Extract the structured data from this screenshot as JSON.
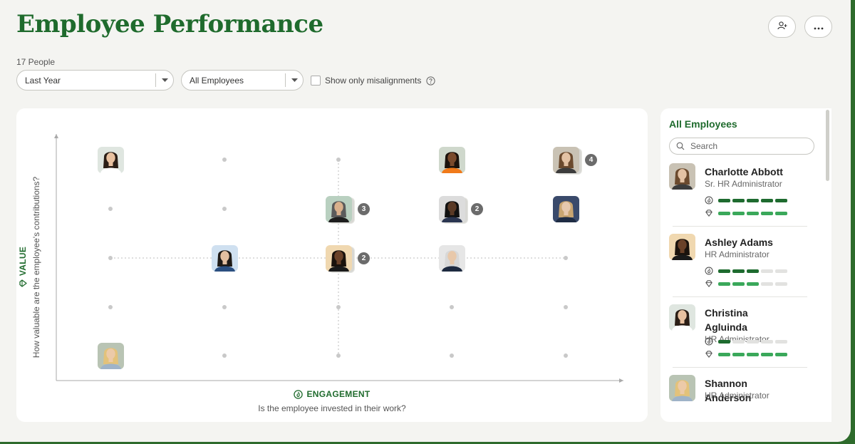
{
  "page": {
    "title": "Employee Performance",
    "people_count": "17 People"
  },
  "header_actions": {
    "add_person_icon": "add-person-icon",
    "more_icon": "more-icon"
  },
  "filters": {
    "period": "Last Year",
    "group": "All Employees",
    "misalignments_label": "Show only misalignments",
    "misalignments_checked": false
  },
  "chart": {
    "x_label": "ENGAGEMENT",
    "x_question": "Is the employee invested in their work?",
    "y_label": "VALUE",
    "y_question": "How valuable are the employee's contributions?",
    "grid_columns": 5,
    "grid_rows": 5,
    "cells": [
      {
        "col": 1,
        "row": 5,
        "count": 1,
        "skin": "#e8c1a0",
        "hair": "#2b1e16",
        "shirt": "#ffffff",
        "bg": "#dfe6e0"
      },
      {
        "col": 4,
        "row": 5,
        "count": 1,
        "skin": "#7a4a2c",
        "hair": "#1b120c",
        "shirt": "#f07a1a",
        "bg": "#cfd8cc"
      },
      {
        "col": 5,
        "row": 5,
        "count": 4,
        "skin": "#e3c2a4",
        "hair": "#6b4a2e",
        "shirt": "#3c3c3c",
        "bg": "#c9c2b4"
      },
      {
        "col": 3,
        "row": 4,
        "count": 3,
        "skin": "#d9b08c",
        "hair": "#5b5b5b",
        "shirt": "#1e1e1e",
        "bg": "#b9d0c0"
      },
      {
        "col": 4,
        "row": 4,
        "count": 2,
        "skin": "#5a3a26",
        "hair": "#111111",
        "shirt": "#2a3550",
        "bg": "#dcdcdc"
      },
      {
        "col": 5,
        "row": 4,
        "count": 1,
        "skin": "#e6c8ae",
        "hair": "#c9a571",
        "shirt": "#1f2c44",
        "bg": "#3a4a6b"
      },
      {
        "col": 2,
        "row": 3,
        "count": 1,
        "skin": "#e3bfa0",
        "hair": "#1f1a16",
        "shirt": "#2b4f80",
        "bg": "#cfe0f0"
      },
      {
        "col": 3,
        "row": 3,
        "count": 2,
        "skin": "#6a4128",
        "hair": "#1a120c",
        "shirt": "#1a1a1a",
        "bg": "#f0d8b0"
      },
      {
        "col": 4,
        "row": 3,
        "count": 1,
        "skin": "#e8c8aa",
        "hair": "#d8d8d8",
        "shirt": "#1e2a40",
        "bg": "#e6e6e6"
      },
      {
        "col": 1,
        "row": 1,
        "count": 1,
        "skin": "#eccaa8",
        "hair": "#e3c27a",
        "shirt": "#9fb3c8",
        "bg": "#b9c4b4"
      }
    ]
  },
  "sidebar": {
    "title": "All Employees",
    "search_placeholder": "Search",
    "engagement_icon": "engagement-icon",
    "value_icon": "value-icon",
    "employees": [
      {
        "name": "Charlotte Abbott",
        "role": "Sr. HR Administrator",
        "engagement": 5,
        "value": 5,
        "skin": "#e3c2a4",
        "hair": "#6b4a2e",
        "shirt": "#3c3c3c",
        "bg": "#c9c2b4"
      },
      {
        "name": "Ashley Adams",
        "role": "HR Administrator",
        "engagement": 3,
        "value": 3,
        "skin": "#6a4128",
        "hair": "#1a120c",
        "shirt": "#1a1a1a",
        "bg": "#f0d8b0"
      },
      {
        "name": "Christina Agluinda",
        "role": "HR Administrator",
        "engagement": 1,
        "value": 5,
        "skin": "#e8c1a0",
        "hair": "#2b1e16",
        "shirt": "#ffffff",
        "bg": "#dfe6e0"
      },
      {
        "name": "Shannon Anderson",
        "role": "HR Administrator",
        "skin": "#eccaa8",
        "hair": "#e3c27a",
        "shirt": "#9fb3c8",
        "bg": "#b9c4b4"
      }
    ]
  }
}
